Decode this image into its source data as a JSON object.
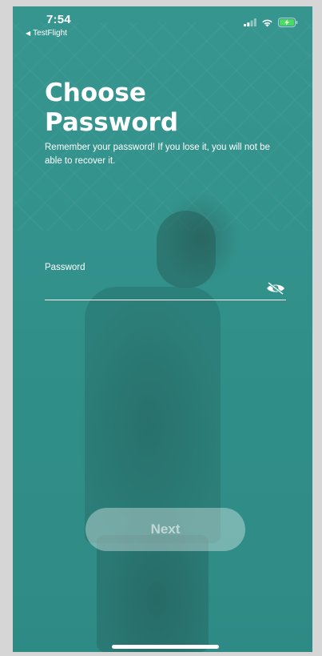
{
  "status_bar": {
    "time": "7:54",
    "back_app": "TestFlight",
    "battery_color": "#4cd964"
  },
  "screen": {
    "title": "Choose Password",
    "subtitle": "Remember your password! If you lose it, you will not be able to recover it.",
    "accent": "#34968f"
  },
  "password_field": {
    "label": "Password",
    "value": "",
    "placeholder": "",
    "toggle_icon": "eye-slash-icon"
  },
  "actions": {
    "next_label": "Next"
  }
}
